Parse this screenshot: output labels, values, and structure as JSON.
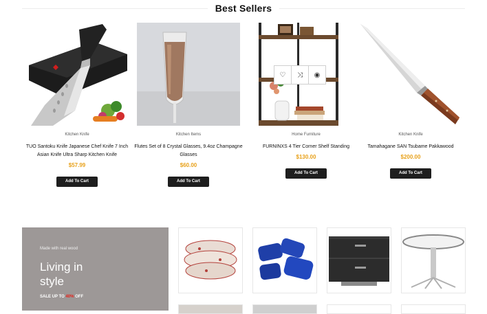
{
  "section": {
    "title": "Best Sellers"
  },
  "products": [
    {
      "category": "Kitchen Knife",
      "title": "TUO Santoku Knife Japanese Chef Knife 7 Inch Asian Knife Ultra Sharp Kitchen Knife",
      "price": "$57.99",
      "button": "Add To Cart"
    },
    {
      "category": "Kitchen Items",
      "title": "Flutes Set of 8 Crystal Glasses, 9.4oz Champagne Glasses",
      "price": "$60.00",
      "button": "Add To Cart"
    },
    {
      "category": "Home Furniture",
      "title": "FURNINXS 4 Tier Corner Shelf Standing",
      "price": "$130.00",
      "button": "Add To Cart"
    },
    {
      "category": "Kitchen Knife",
      "title": "Tamahagane SAN Tsubame Pakkawood",
      "price": "$200.00",
      "button": "Add To Cart"
    }
  ],
  "hover_actions": [
    {
      "icon": "heart-icon",
      "glyph": "♡"
    },
    {
      "icon": "shuffle-icon",
      "glyph": "⤨"
    },
    {
      "icon": "eye-icon",
      "glyph": "◉"
    }
  ],
  "banner": {
    "subtitle": "Made with real wood",
    "title_line1": "Living in",
    "title_line2": "style",
    "sale_prefix": "SALE UP TO ",
    "sale_percent": "40%",
    "sale_suffix": " OFF"
  },
  "colors": {
    "price": "#e8a11a",
    "button": "#1e1e1e",
    "sale_percent": "#e8231a",
    "banner_bg": "#9d9897"
  }
}
